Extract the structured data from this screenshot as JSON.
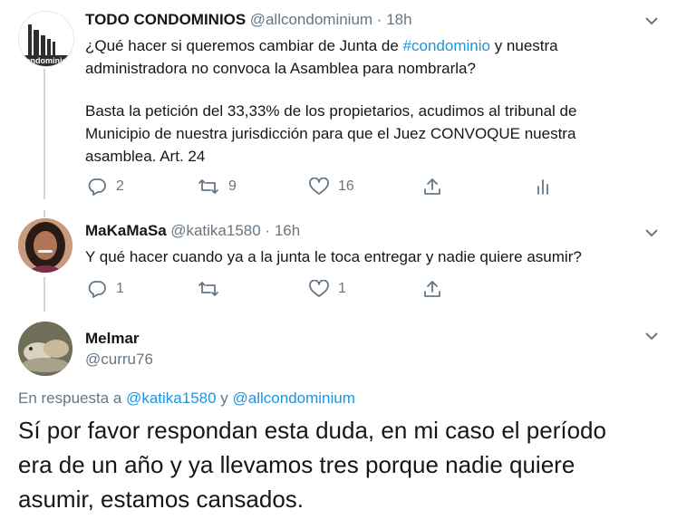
{
  "tweet1": {
    "name": "TODO CONDOMINIOS",
    "handle": "@allcondominium",
    "sep": " · ",
    "time": "18h",
    "avatar_text": "ondominio",
    "line1_pre": "¿Qué hacer si queremos cambiar de Junta de ",
    "hashtag": "#condominio",
    "line1_post": " y nuestra",
    "line2": "administradora no convoca la Asamblea para nombrarla?",
    "line3": "Basta la petición del 33,33% de los propietarios, acudimos al tribunal de",
    "line4": "Municipio de nuestra jurisdicción para que el Juez CONVOQUE nuestra",
    "line5": "asamblea. Art. 24",
    "replies": "2",
    "retweets": "9",
    "likes": "16"
  },
  "tweet2": {
    "name": "MaKaMaSa",
    "handle": "@katika1580",
    "sep": " · ",
    "time": "16h",
    "text": "Y qué hacer cuando ya a la junta le toca entregar y nadie quiere asumir?",
    "replies": "1",
    "likes": "1"
  },
  "tweet3": {
    "name": "Melmar",
    "handle": "@curru76",
    "reply_prefix": "En respuesta a ",
    "reply_user1": "@katika1580",
    "reply_and": " y ",
    "reply_user2": "@allcondominium",
    "line1": "Sí por favor respondan esta duda, en mi caso el período",
    "line2": "era de un año y ya llevamos tres porque nadie quiere",
    "line3": "asumir, estamos cansados."
  },
  "colors": {
    "link": "#1b95e0",
    "secondary": "#657786",
    "text": "#14171a",
    "thread": "#ccd6dd"
  },
  "icons": [
    "reply-icon",
    "retweet-icon",
    "like-icon",
    "share-icon",
    "analytics-icon",
    "chevron-down-icon"
  ]
}
